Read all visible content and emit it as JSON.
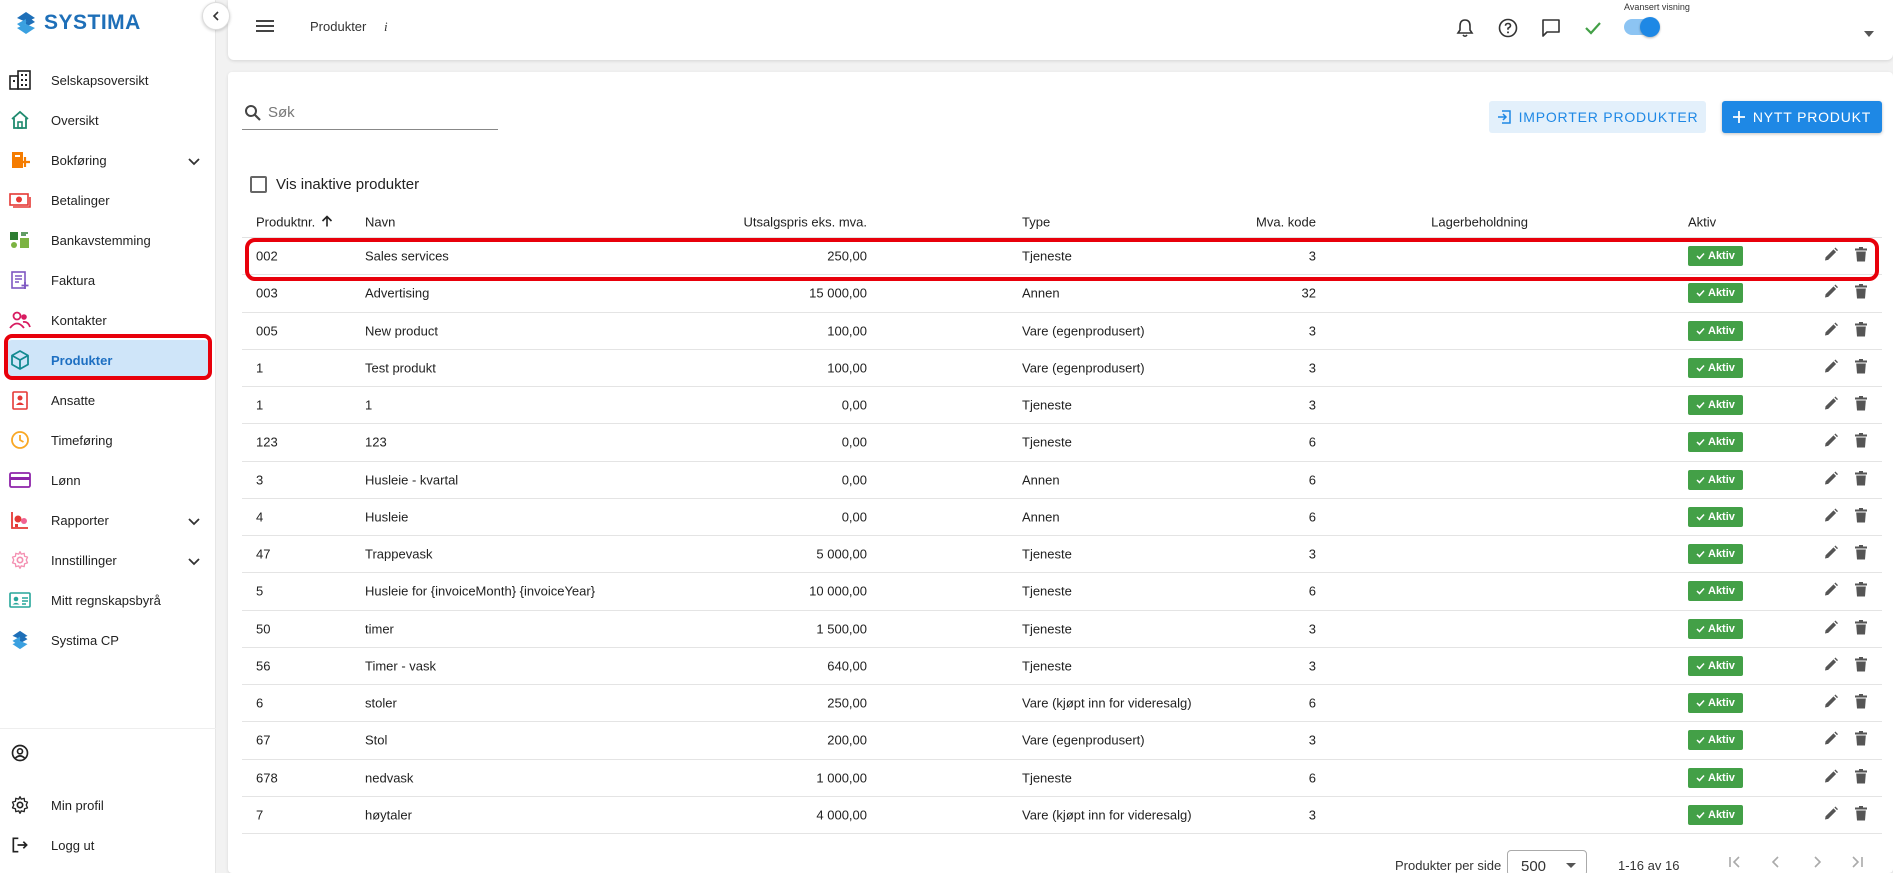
{
  "app": {
    "brand": "SYSTIMA",
    "brand_color": "#1e6fb8",
    "accent_color": "#1e88e5",
    "active_badge_color": "#43a047",
    "highlight_color": "#e8000b"
  },
  "sidebar": {
    "items": [
      {
        "label": "Selskapsoversikt",
        "icon": "buildings-icon"
      },
      {
        "label": "Oversikt",
        "icon": "home-icon"
      },
      {
        "label": "Bokføring",
        "icon": "bookkeeping-icon",
        "expandable": true
      },
      {
        "label": "Betalinger",
        "icon": "payments-icon"
      },
      {
        "label": "Bankavstemming",
        "icon": "bank-reconcile-icon"
      },
      {
        "label": "Faktura",
        "icon": "invoice-icon"
      },
      {
        "label": "Kontakter",
        "icon": "contacts-icon"
      },
      {
        "label": "Produkter",
        "icon": "cube-icon",
        "active": true
      },
      {
        "label": "Ansatte",
        "icon": "employee-badge-icon"
      },
      {
        "label": "Timeføring",
        "icon": "clock-icon"
      },
      {
        "label": "Lønn",
        "icon": "card-icon"
      },
      {
        "label": "Rapporter",
        "icon": "reports-icon",
        "expandable": true
      },
      {
        "label": "Innstillinger",
        "icon": "settings-icon",
        "expandable": true
      },
      {
        "label": "Mitt regnskapsbyrå",
        "icon": "id-card-icon"
      },
      {
        "label": "Systima CP",
        "icon": "systima-logo-icon"
      }
    ],
    "bottom": {
      "profile_label": "Min profil",
      "logout_label": "Logg ut"
    }
  },
  "topbar": {
    "title": "Produkter",
    "info": "i",
    "advanced_view_label": "Avansert visning",
    "advanced_view_on": true
  },
  "main": {
    "search_placeholder": "Søk",
    "import_button": "IMPORTER PRODUKTER",
    "new_button": "NYTT PRODUKT",
    "show_inactive_label": "Vis inaktive produkter",
    "columns": {
      "nr": "Produktnr.",
      "navn": "Navn",
      "pris": "Utsalgspris eks. mva.",
      "type": "Type",
      "mva": "Mva. kode",
      "lager": "Lagerbeholdning",
      "aktiv": "Aktiv"
    },
    "active_label": "Aktiv",
    "rows": [
      {
        "nr": "002",
        "navn": "Sales services",
        "pris": "250,00",
        "type": "Tjeneste",
        "mva": "3",
        "lager": ""
      },
      {
        "nr": "003",
        "navn": "Advertising",
        "pris": "15 000,00",
        "type": "Annen",
        "mva": "32",
        "lager": ""
      },
      {
        "nr": "005",
        "navn": "New product",
        "pris": "100,00",
        "type": "Vare (egenprodusert)",
        "mva": "3",
        "lager": ""
      },
      {
        "nr": "1",
        "navn": "Test produkt",
        "pris": "100,00",
        "type": "Vare (egenprodusert)",
        "mva": "3",
        "lager": ""
      },
      {
        "nr": "1",
        "navn": "1",
        "pris": "0,00",
        "type": "Tjeneste",
        "mva": "3",
        "lager": ""
      },
      {
        "nr": "123",
        "navn": "123",
        "pris": "0,00",
        "type": "Tjeneste",
        "mva": "6",
        "lager": ""
      },
      {
        "nr": "3",
        "navn": "Husleie - kvartal",
        "pris": "0,00",
        "type": "Annen",
        "mva": "6",
        "lager": ""
      },
      {
        "nr": "4",
        "navn": "Husleie",
        "pris": "0,00",
        "type": "Annen",
        "mva": "6",
        "lager": ""
      },
      {
        "nr": "47",
        "navn": "Trappevask",
        "pris": "5 000,00",
        "type": "Tjeneste",
        "mva": "3",
        "lager": ""
      },
      {
        "nr": "5",
        "navn": "Husleie for {invoiceMonth} {invoiceYear}",
        "pris": "10 000,00",
        "type": "Tjeneste",
        "mva": "6",
        "lager": ""
      },
      {
        "nr": "50",
        "navn": "timer",
        "pris": "1 500,00",
        "type": "Tjeneste",
        "mva": "3",
        "lager": ""
      },
      {
        "nr": "56",
        "navn": "Timer - vask",
        "pris": "640,00",
        "type": "Tjeneste",
        "mva": "3",
        "lager": ""
      },
      {
        "nr": "6",
        "navn": "stoler",
        "pris": "250,00",
        "type": "Vare (kjøpt inn for videresalg)",
        "mva": "6",
        "lager": ""
      },
      {
        "nr": "67",
        "navn": "Stol",
        "pris": "200,00",
        "type": "Vare (egenprodusert)",
        "mva": "3",
        "lager": ""
      },
      {
        "nr": "678",
        "navn": "nedvask",
        "pris": "1 000,00",
        "type": "Tjeneste",
        "mva": "6",
        "lager": ""
      },
      {
        "nr": "7",
        "navn": "høytaler",
        "pris": "4 000,00",
        "type": "Vare (kjøpt inn for videresalg)",
        "mva": "3",
        "lager": ""
      }
    ],
    "pagination": {
      "per_page_label": "Produkter per side",
      "per_page_value": "500",
      "range": "1-16 av 16"
    }
  }
}
